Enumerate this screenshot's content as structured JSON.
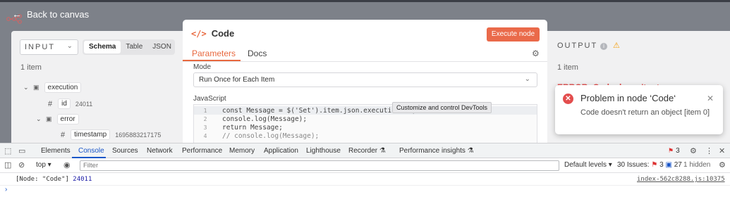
{
  "canvas": {
    "back_label": "Back to canvas"
  },
  "input_panel": {
    "display_label": "INPUT",
    "view_tabs": [
      "Schema",
      "Table",
      "JSON"
    ],
    "items_count": "1 item",
    "tree": [
      {
        "key": "execution",
        "type": "object",
        "depth": 0
      },
      {
        "key": "id",
        "type": "number",
        "value": "24011",
        "depth": 1
      },
      {
        "key": "error",
        "type": "object",
        "depth": 1
      },
      {
        "key": "timestamp",
        "type": "number",
        "value": "1695883217175",
        "depth": 2
      }
    ]
  },
  "modal": {
    "title": "Code",
    "execute_label": "Execute node",
    "tabs": [
      "Parameters",
      "Docs"
    ],
    "mode_label": "Mode",
    "mode_value": "Run Once for Each Item",
    "js_label": "JavaScript",
    "code_lines": [
      {
        "n": "1",
        "text": "const Message = $('Set').item.json.execution.id;"
      },
      {
        "n": "2",
        "text": "console.log(Message);"
      },
      {
        "n": "3",
        "text": "return Message;"
      },
      {
        "n": "4",
        "text": "// console.log(Message);"
      }
    ],
    "tooltip": "Customize and control DevTools"
  },
  "output_panel": {
    "label": "OUTPUT",
    "items_count": "1 item",
    "error_peek": "ERROR: Code doesn't return an"
  },
  "toast": {
    "title": "Problem in node ‘Code‘",
    "message": "Code doesn't return an object [item 0]"
  },
  "devtools": {
    "tabs": [
      "Elements",
      "Console",
      "Sources",
      "Network",
      "Performance",
      "Memory",
      "Application",
      "Lighthouse",
      "Recorder ⚗",
      "Performance insights ⚗"
    ],
    "active_tab": "Console",
    "issue_badge": "3",
    "context": "top ▾",
    "filter_placeholder": "Filter",
    "levels": "Default levels ▾",
    "issues_summary_prefix": "30 Issues:",
    "issues_errors": "3",
    "issues_info": "27",
    "hidden": "1 hidden",
    "console_message_prefix": "[Node: \"Code\"]",
    "console_message_value": "24011",
    "console_source": "index-562c8288.js:10375"
  },
  "colors": {
    "accent": "#ea6a4a",
    "error": "#e34d4d",
    "devtools_accent": "#1a56c8"
  }
}
